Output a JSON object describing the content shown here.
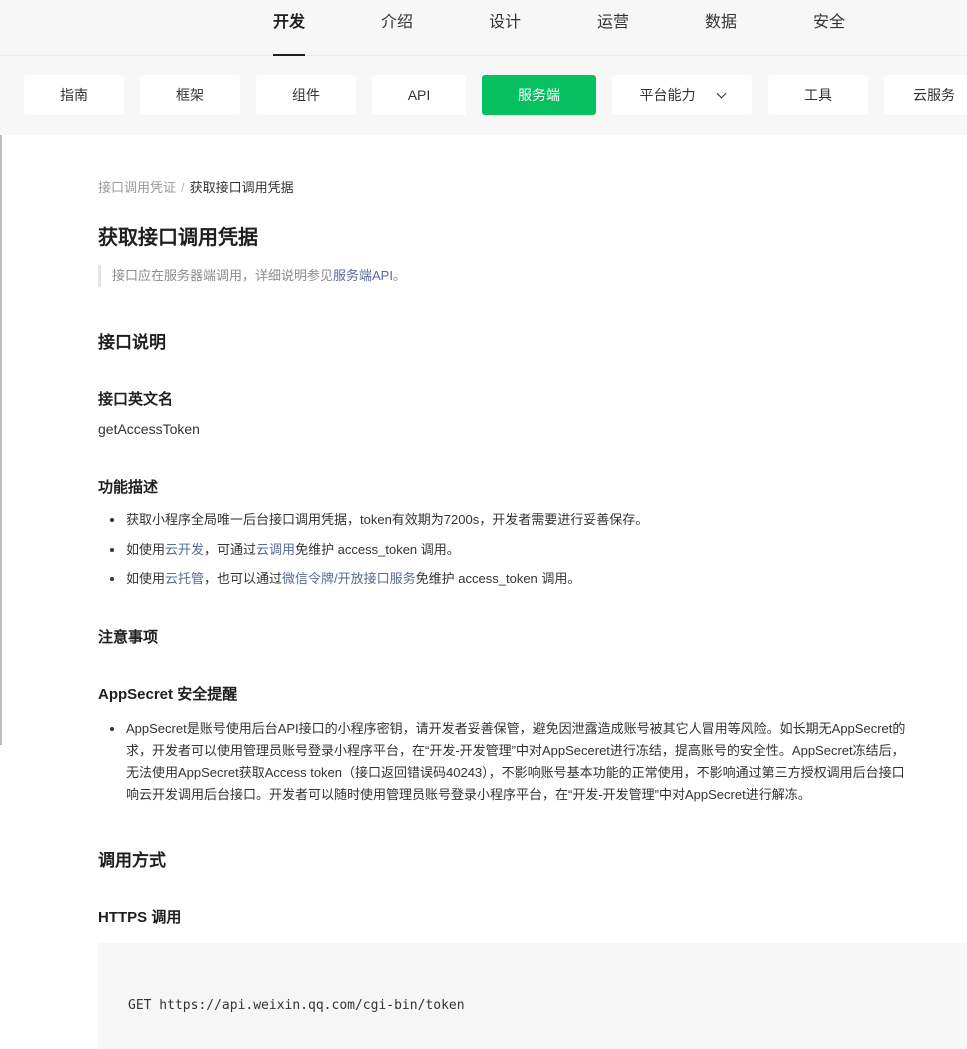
{
  "top_nav": {
    "tabs": [
      {
        "label": "开发",
        "active": true
      },
      {
        "label": "介绍",
        "active": false
      },
      {
        "label": "设计",
        "active": false
      },
      {
        "label": "运营",
        "active": false
      },
      {
        "label": "数据",
        "active": false
      },
      {
        "label": "安全",
        "active": false
      }
    ]
  },
  "sub_nav": {
    "items": [
      {
        "label": "指南"
      },
      {
        "label": "框架"
      },
      {
        "label": "组件"
      },
      {
        "label": "API"
      },
      {
        "label": "服务端",
        "active": true
      },
      {
        "label": "平台能力",
        "dropdown": true
      },
      {
        "label": "工具"
      },
      {
        "label": "云服务"
      }
    ],
    "accent_color": "#07c160"
  },
  "breadcrumb": {
    "parent": "接口调用凭证",
    "separator": "/",
    "current": "获取接口调用凭据"
  },
  "page_title": "获取接口调用凭据",
  "note": {
    "text": "接口应在服务器端调用，详细说明参见",
    "link": "服务端API",
    "suffix": "。"
  },
  "section_interface": "接口说明",
  "english_name": {
    "heading": "接口英文名",
    "value": "getAccessToken"
  },
  "description": {
    "heading": "功能描述",
    "bullet1": "获取小程序全局唯一后台接口调用凭据，token有效期为7200s，开发者需要进行妥善保存。",
    "bullet2": {
      "p1": "如使用",
      "link1": "云开发",
      "p2": "，可通过",
      "link2": "云调用",
      "p3": "免维护 access_token 调用。"
    },
    "bullet3": {
      "p1": "如使用",
      "link1": "云托管",
      "p2": "，也可以通过",
      "link2": "微信令牌/开放接口服务",
      "p3": "免维护 access_token 调用。"
    }
  },
  "notes": {
    "heading": "注意事项"
  },
  "appsecret": {
    "heading": "AppSecret 安全提醒",
    "lines": [
      "AppSecret是账号使用后台API接口的小程序密钥，请开发者妥善保管，避免因泄露造成账号被其它人冒用等风险。如长期无AppSecret的",
      "求，开发者可以使用管理员账号登录小程序平台，在“开发-开发管理”中对AppSeceret进行冻结，提高账号的安全性。AppSecret冻结后，",
      "无法使用AppSecret获取Access token（接口返回错误码40243），不影响账号基本功能的正常使用，不影响通过第三方授权调用后台接口",
      "响云开发调用后台接口。开发者可以随时使用管理员账号登录小程序平台，在“开发-开发管理”中对AppSecret进行解冻。"
    ]
  },
  "call_method": {
    "heading": "调用方式",
    "https_heading": "HTTPS 调用",
    "code": "GET https://api.weixin.qq.com/cgi-bin/token"
  },
  "colors": {
    "link": "#576b95",
    "accent": "#07c160"
  }
}
